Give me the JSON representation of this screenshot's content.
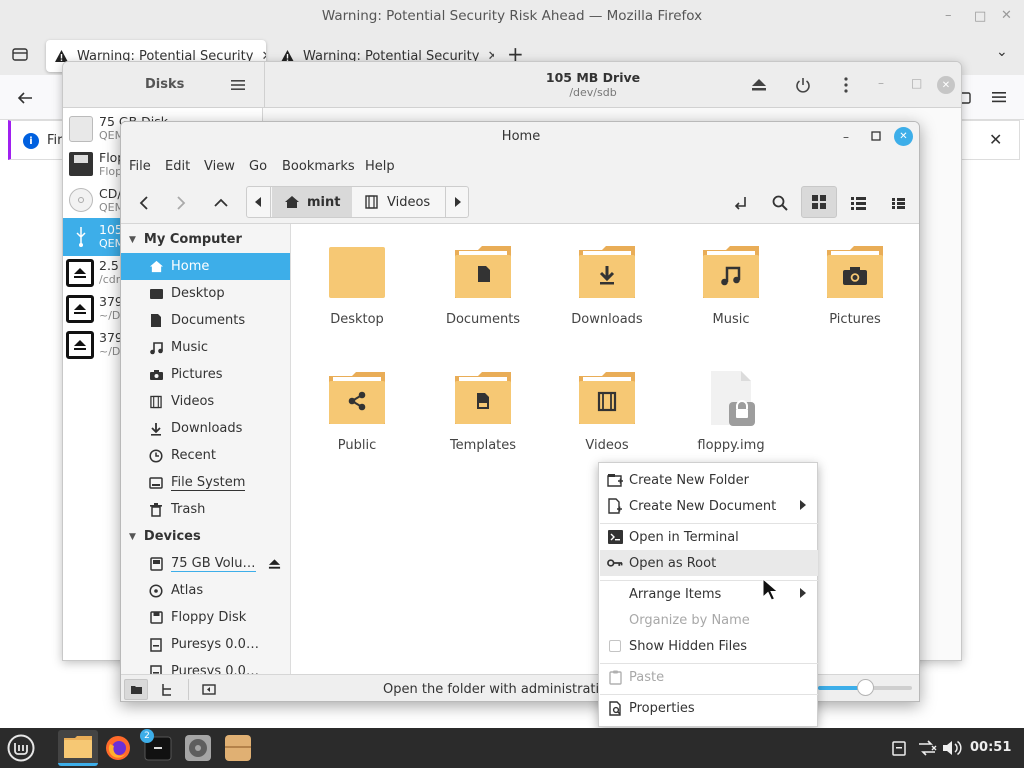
{
  "firefox": {
    "window_title": "Warning: Potential Security Risk Ahead — Mozilla Firefox",
    "tabs": [
      {
        "label": "Warning: Potential Security"
      },
      {
        "label": "Warning: Potential Security"
      }
    ],
    "notification_text": "Fir"
  },
  "disks": {
    "title": "Disks",
    "drive_title": "105 MB Drive",
    "drive_path": "/dev/sdb",
    "drives": [
      {
        "name": "75 GB Disk",
        "sub": "QEM"
      },
      {
        "name": "Flop",
        "sub": "Flop"
      },
      {
        "name": "CD/",
        "sub": "QEM"
      },
      {
        "name": "105",
        "sub": "QEM"
      },
      {
        "name": "2.5",
        "sub": "/cdr"
      },
      {
        "name": "379",
        "sub": "~/Do"
      },
      {
        "name": "379",
        "sub": "~/Do"
      }
    ]
  },
  "nemo": {
    "title": "Home",
    "menu": [
      "File",
      "Edit",
      "View",
      "Go",
      "Bookmarks",
      "Help"
    ],
    "path": [
      "mint",
      "Videos"
    ],
    "sidebar": {
      "my_computer": "My Computer",
      "places": [
        "Home",
        "Desktop",
        "Documents",
        "Music",
        "Pictures",
        "Videos",
        "Downloads",
        "Recent",
        "File System",
        "Trash"
      ],
      "devices_header": "Devices",
      "devices": [
        "75 GB Volu…",
        "Atlas",
        "Floppy Disk",
        "Puresys 0.0…",
        "Puresys 0.0…"
      ]
    },
    "files": [
      {
        "name": "Desktop",
        "icon": "folder"
      },
      {
        "name": "Documents",
        "icon": "folder-documents"
      },
      {
        "name": "Downloads",
        "icon": "folder-download"
      },
      {
        "name": "Music",
        "icon": "folder-music"
      },
      {
        "name": "Pictures",
        "icon": "folder-pictures"
      },
      {
        "name": "Public",
        "icon": "folder-publicshare"
      },
      {
        "name": "Templates",
        "icon": "folder-templates"
      },
      {
        "name": "Videos",
        "icon": "folder-videos"
      },
      {
        "name": "floppy.img",
        "icon": "locked-file"
      }
    ],
    "status_text": "Open the folder with administration",
    "zoom_fraction": 0.5
  },
  "context_menu": {
    "items": [
      {
        "label": "Create New Folder",
        "enabled": true
      },
      {
        "label": "Create New Document",
        "enabled": true,
        "submenu": true
      },
      {
        "label": "Open in Terminal",
        "enabled": true
      },
      {
        "label": "Open as Root",
        "enabled": true,
        "highlighted": true
      },
      {
        "label": "Arrange Items",
        "enabled": true,
        "submenu": true
      },
      {
        "label": "Organize by Name",
        "enabled": false
      },
      {
        "label": "Show Hidden Files",
        "enabled": true,
        "checkbox": true,
        "checked": false
      },
      {
        "label": "Paste",
        "enabled": false
      },
      {
        "label": "Properties",
        "enabled": true
      }
    ]
  },
  "taskbar": {
    "terminal_badge": "2",
    "clock": "00:51"
  },
  "colors": {
    "accent": "#3daee9",
    "folder": "#f6c874",
    "folder_tab": "#e9ad57",
    "taskbar": "#2b2b2b"
  }
}
